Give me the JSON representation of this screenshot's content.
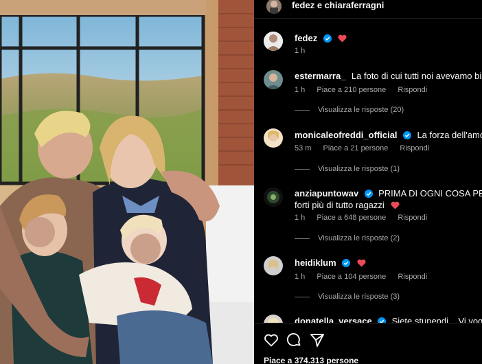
{
  "header": {
    "title": "fedez e chiaraferragni"
  },
  "post": {
    "author": "fedez",
    "time": "1 h"
  },
  "comments": [
    {
      "user": "estermarra_",
      "text": "La foto di cui tutti noi avevamo bisogno",
      "time": "1 h",
      "likes": "Piace a 210 persone",
      "reply": "Rispondi",
      "view_replies": "Visualizza le risposte (20)",
      "verified": false
    },
    {
      "user": "monicaleofreddi_official",
      "text": "La forza dell'amore.",
      "time": "53 m",
      "likes": "Piace a 21 persone",
      "reply": "Rispondi",
      "view_replies": "Visualizza le risposte (1)",
      "verified": true
    },
    {
      "user": "anziapuntowav",
      "text": "PRIMA DI OGNI COSA PER DAVVE",
      "text2": "forti più di tutto ragazzi",
      "time": "1 h",
      "likes": "Piace a 648 persone",
      "reply": "Rispondi",
      "view_replies": "Visualizza le risposte (2)",
      "verified": true
    },
    {
      "user": "heidiklum",
      "text": "",
      "time": "1 h",
      "likes": "Piace a 104 persone",
      "reply": "Rispondi",
      "view_replies": "Visualizza le risposte (3)",
      "verified": true
    },
    {
      "user": "donatella_versace",
      "text": "Siete stupendi... Vi voglio bene",
      "verified": true
    }
  ],
  "footer": {
    "likes": "Piace a 374.313 persone"
  },
  "icons": {
    "like": "heart-outline-icon",
    "comment": "comment-bubble-icon",
    "share": "paper-plane-icon",
    "verified": "verified-badge-icon",
    "heart": "red-heart-icon"
  },
  "colors": {
    "verified": "#0095f6",
    "heart": "#ed4956",
    "muted": "#a8a8a8"
  }
}
